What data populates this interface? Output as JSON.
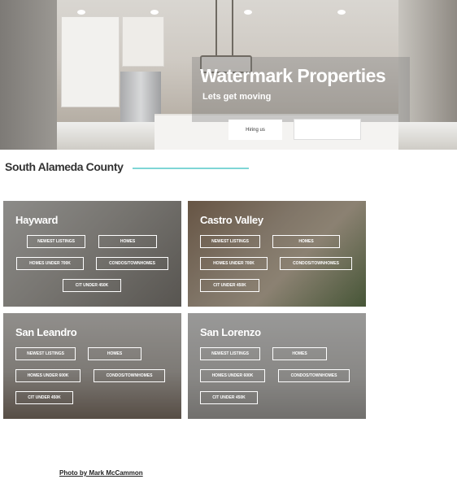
{
  "hero": {
    "title": "Watermark Properties",
    "subtitle": "Lets get moving",
    "hire_button_label": "Hiring us",
    "second_button_label": ""
  },
  "section": {
    "title": "South Alameda County",
    "accent_color": "#7fd6d6"
  },
  "cards": [
    {
      "title": "Hayward",
      "tags": [
        "NEWEST LISTINGS",
        "HOMES",
        "HOMES UNDER 700K",
        "CONDOS/TOWNHOMES",
        "CIT UNDER 450K"
      ]
    },
    {
      "title": "Castro Valley",
      "tags": [
        "NEWEST LISTINGS",
        "HOMES",
        "HOMES UNDER 700K",
        "CONDOS/TOWNHOMES",
        "CIT UNDER 450K"
      ]
    },
    {
      "title": "San Leandro",
      "tags": [
        "NEWEST LISTINGS",
        "HOMES",
        "HOMES UNDER 600K",
        "CONDOS/TOWNHOMES",
        "CIT UNDER 450K"
      ]
    },
    {
      "title": "San Lorenzo",
      "tags": [
        "NEWEST LISTINGS",
        "HOMES",
        "HOMES UNDER 600K",
        "CONDOS/TOWNHOMES",
        "CIT UNDER 450K"
      ]
    }
  ],
  "footer": {
    "photo_credit": "Photo by Mark McCammon"
  }
}
